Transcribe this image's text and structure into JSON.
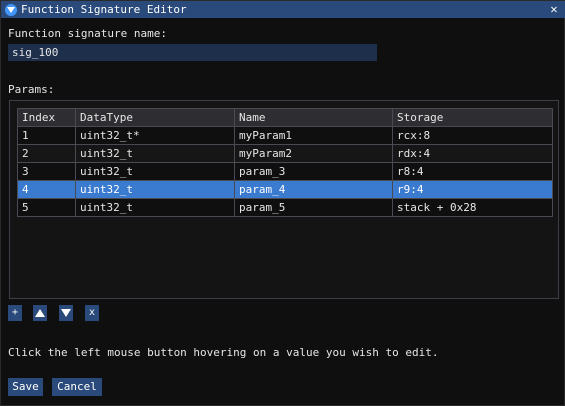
{
  "window": {
    "title": "Function Signature Editor",
    "close_glyph": "✕"
  },
  "signature": {
    "label": "Function signature name:",
    "value": "sig_100"
  },
  "params": {
    "label": "Params:",
    "columns": [
      "Index",
      "DataType",
      "Name",
      "Storage"
    ],
    "rows": [
      [
        "1",
        "uint32_t*",
        "myParam1",
        "rcx:8"
      ],
      [
        "2",
        "uint32_t",
        "myParam2",
        "rdx:4"
      ],
      [
        "3",
        "uint32_t",
        "param_3",
        "r8:4"
      ],
      [
        "4",
        "uint32_t",
        "param_4",
        "r9:4"
      ],
      [
        "5",
        "uint32_t",
        "param_5",
        "stack + 0x28"
      ]
    ],
    "selected_row": 3
  },
  "row_buttons": {
    "add": "+",
    "move_up_icon": "triangle-up-icon",
    "move_down_icon": "triangle-down-icon",
    "remove": "x"
  },
  "help_text": "Click the left mouse button hovering on a value you wish to edit.",
  "actions": {
    "save": "Save",
    "cancel": "Cancel"
  },
  "colors": {
    "titlebar": "#294a7a",
    "button": "#294a7a",
    "selected_row": "#3a7bd0",
    "input_bg": "#1d2f4b"
  }
}
